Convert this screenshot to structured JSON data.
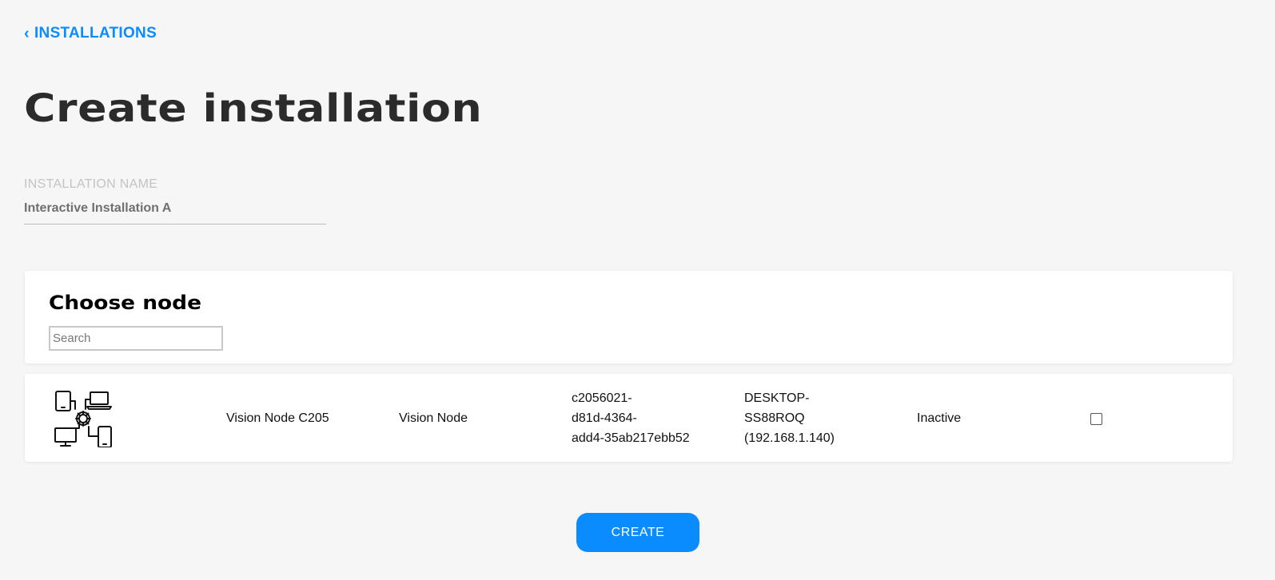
{
  "nav": {
    "back_label": "INSTALLATIONS"
  },
  "page": {
    "title": "Create installation"
  },
  "form": {
    "installation_name_label": "INSTALLATION NAME",
    "installation_name_value": "Interactive Installation A"
  },
  "node_picker": {
    "heading": "Choose node",
    "search_placeholder": "Search",
    "nodes": [
      {
        "icon": "devices-network-icon",
        "name": "Vision Node C205",
        "type": "Vision Node",
        "id_lines": [
          "c2056021-",
          "d81d-4364-",
          "add4-35ab217ebb52"
        ],
        "host_lines": [
          "DESKTOP-",
          "SS88ROQ",
          "(192.168.1.140)"
        ],
        "status": "Inactive",
        "selected": false
      }
    ]
  },
  "actions": {
    "create_label": "CREATE"
  },
  "colors": {
    "accent": "#0a8cff",
    "background": "#f6f6f6",
    "title": "#2b2b2b"
  }
}
